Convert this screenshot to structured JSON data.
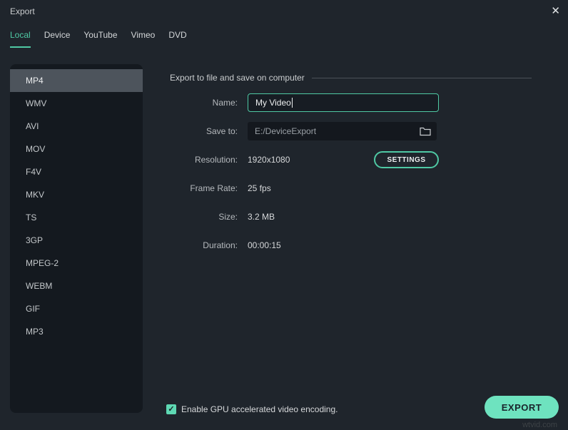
{
  "window": {
    "title": "Export",
    "close_glyph": "✕"
  },
  "tabs": {
    "items": [
      {
        "label": "Local",
        "active": true
      },
      {
        "label": "Device",
        "active": false
      },
      {
        "label": "YouTube",
        "active": false
      },
      {
        "label": "Vimeo",
        "active": false
      },
      {
        "label": "DVD",
        "active": false
      }
    ]
  },
  "sidebar": {
    "selected": "MP4",
    "formats": [
      "MP4",
      "WMV",
      "AVI",
      "MOV",
      "F4V",
      "MKV",
      "TS",
      "3GP",
      "MPEG-2",
      "WEBM",
      "GIF",
      "MP3"
    ]
  },
  "main": {
    "section_title": "Export to file and save on computer",
    "fields": {
      "name": {
        "label": "Name:",
        "value": "My Video"
      },
      "save_to": {
        "label": "Save to:",
        "value": "E:/DeviceExport",
        "icon": "folder-icon"
      },
      "resolution": {
        "label": "Resolution:",
        "value": "1920x1080",
        "settings_button": "SETTINGS"
      },
      "frame_rate": {
        "label": "Frame Rate:",
        "value": "25 fps"
      },
      "size": {
        "label": "Size:",
        "value": "3.2 MB"
      },
      "duration": {
        "label": "Duration:",
        "value": "00:00:15"
      }
    }
  },
  "footer": {
    "gpu_checkbox": {
      "checked": true,
      "check_glyph": "✓",
      "label": "Enable GPU accelerated video encoding."
    },
    "export_button": "EXPORT"
  },
  "watermark": "wtvid.com",
  "colors": {
    "accent": "#4fc9a4",
    "export_button_bg": "#6ee3bf",
    "dialog_bg": "#1f252c",
    "panel_bg": "#14191f",
    "selected_row_bg": "#4d545c"
  }
}
